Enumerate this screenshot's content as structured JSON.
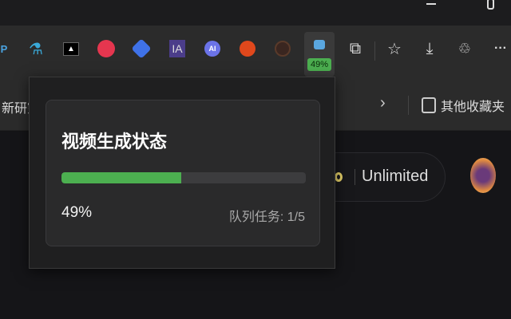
{
  "browser": {
    "window_controls": {
      "minimize_icon": "minimize-icon",
      "restore_icon": "restore-icon"
    },
    "extensions": [
      "p-ext-icon",
      "microscope-icon",
      "a-ext-icon",
      "red-stripes-icon",
      "blue-diamond-icon",
      "IA",
      "AI",
      "reddit-download-icon",
      "brown-face-icon"
    ],
    "active_extension": {
      "name": "video-status-extension",
      "badge": "49%",
      "badge_color": "#4caf50"
    },
    "toolbar_icons": [
      "extensions-puzzle-icon",
      "favorites-icon",
      "download-icon",
      "workspaces-icon",
      "more-icon"
    ],
    "bookmarks": {
      "left_label": "新研究",
      "other_favorites": "其他收藏夹"
    }
  },
  "page": {
    "plan_label": "Unlimited"
  },
  "popup": {
    "title": "视频生成状态",
    "progress_percent": 49,
    "progress_label": "49%",
    "queue_label": "队列任务: 1/5",
    "accent_color": "#4caf50"
  }
}
